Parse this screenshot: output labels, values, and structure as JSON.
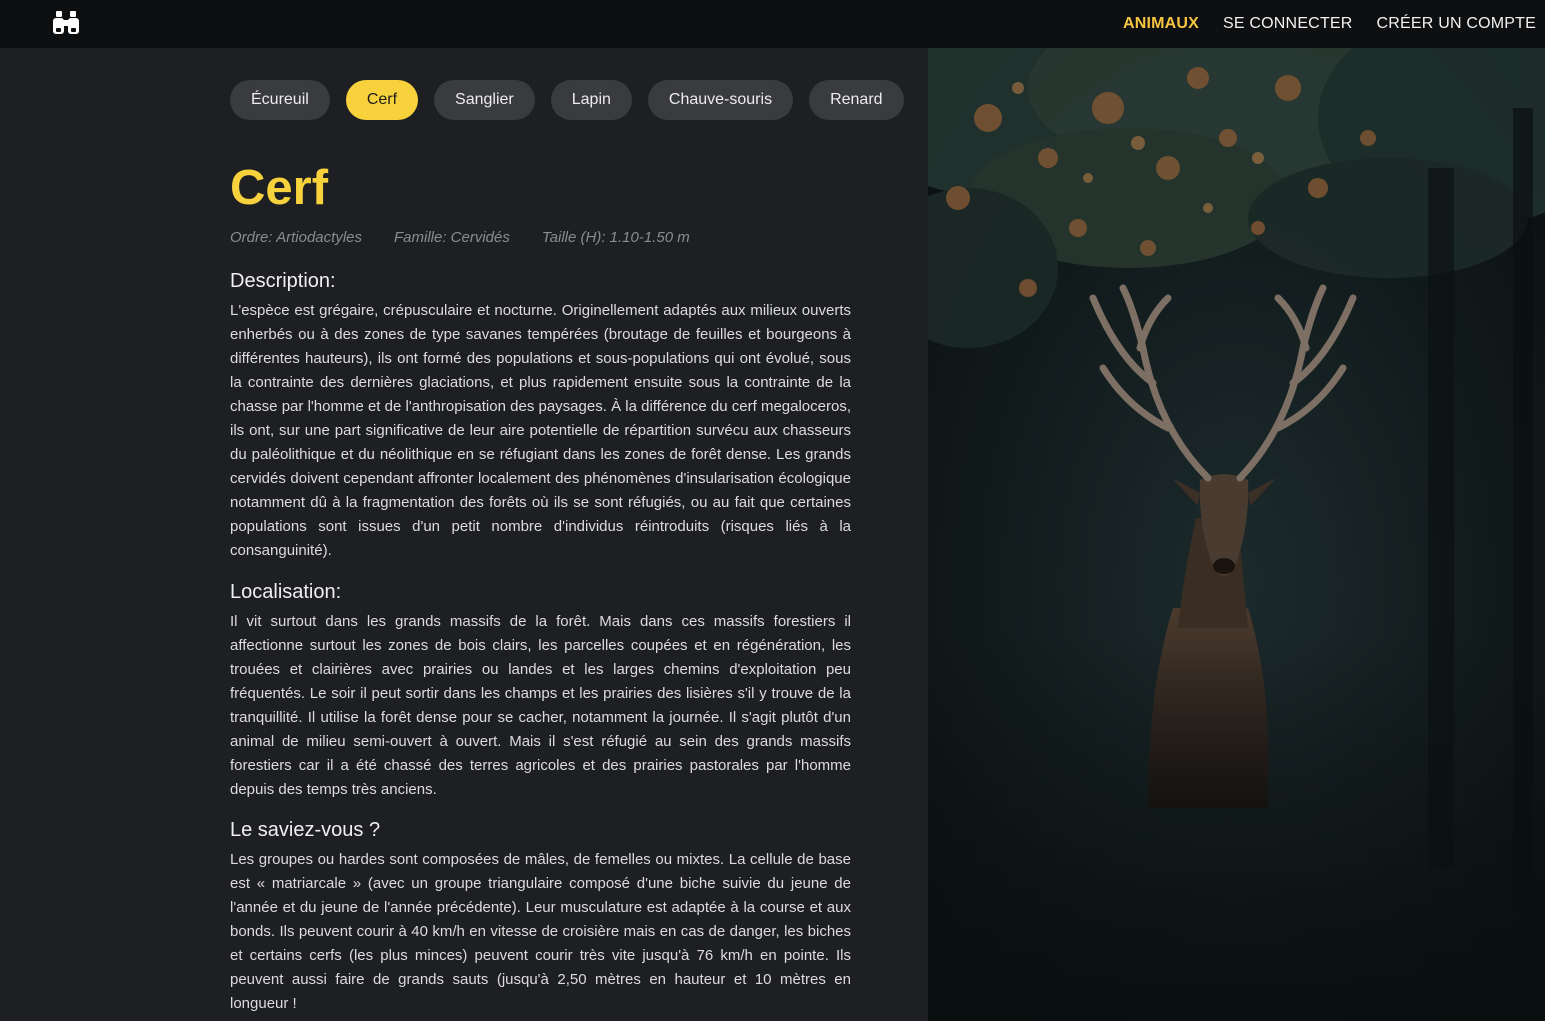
{
  "nav": {
    "items": [
      {
        "label": "ANIMAUX",
        "active": true
      },
      {
        "label": "SE CONNECTER",
        "active": false
      },
      {
        "label": "CRÉER UN COMPTE",
        "active": false
      }
    ]
  },
  "logo": {
    "icon": "binoculars-icon"
  },
  "tabs": [
    {
      "label": "Écureuil",
      "active": false
    },
    {
      "label": "Cerf",
      "active": true
    },
    {
      "label": "Sanglier",
      "active": false
    },
    {
      "label": "Lapin",
      "active": false
    },
    {
      "label": "Chauve-souris",
      "active": false
    },
    {
      "label": "Renard",
      "active": false
    }
  ],
  "animal": {
    "name": "Cerf",
    "ordre": "Ordre: Artiodactyles",
    "famille": "Famille: Cervidés",
    "taille": "Taille (H): 1.10-1.50 m"
  },
  "sections": {
    "description": {
      "heading": "Description:",
      "text": "L'espèce est grégaire, crépusculaire et nocturne. Originellement adaptés aux milieux ouverts enherbés ou à des zones de type savanes tempérées (broutage de feuilles et bourgeons à différentes hauteurs), ils ont formé des populations et sous-populations qui ont évolué, sous la contrainte des dernières glaciations, et plus rapidement ensuite sous la contrainte de la chasse par l'homme et de l'anthropisation des paysages. À la différence du cerf megaloceros, ils ont, sur une part significative de leur aire potentielle de répartition survécu aux chasseurs du paléolithique et du néolithique en se réfugiant dans les zones de forêt dense. Les grands cervidés doivent cependant affronter localement des phénomènes d'insularisation écologique notamment dû à la fragmentation des forêts où ils se sont réfugiés, ou au fait que certaines populations sont issues d'un petit nombre d'individus réintroduits (risques liés à la consanguinité)."
    },
    "localisation": {
      "heading": "Localisation:",
      "text": "Il vit surtout dans les grands massifs de la forêt. Mais dans ces massifs forestiers il affectionne surtout les zones de bois clairs, les parcelles coupées et en régénération, les trouées et clairières avec prairies ou landes et les larges chemins d'exploitation peu fréquentés. Le soir il peut sortir dans les champs et les prairies des lisières s'il y trouve de la tranquillité. Il utilise la forêt dense pour se cacher, notamment la journée. Il s'agit plutôt d'un animal de milieu semi-ouvert à ouvert. Mais il s'est réfugié au sein des grands massifs forestiers car il a été chassé des terres agricoles et des prairies pastorales par l'homme depuis des temps très anciens."
    },
    "saviez": {
      "heading": "Le saviez-vous ?",
      "text": "Les groupes ou hardes sont composées de mâles, de femelles ou mixtes. La cellule de base est « matriarcale » (avec un groupe triangulaire composé d'une biche suivie du jeune de l'année et du jeune de l'année précédente). Leur musculature est adaptée à la course et aux bonds. Ils peuvent courir à 40 km/h en vitesse de croisière mais en cas de danger, les biches et certains cerfs (les plus minces) peuvent courir très vite jusqu'à 76 km/h en pointe. Ils peuvent aussi faire de grands sauts (jusqu'à 2,50 mètres en hauteur et 10 mètres en longueur !"
    }
  },
  "colors": {
    "accent": "#f8d23d",
    "topbar": "#0e0f11",
    "background": "#1e1f22",
    "chip": "#3a3b3e"
  }
}
